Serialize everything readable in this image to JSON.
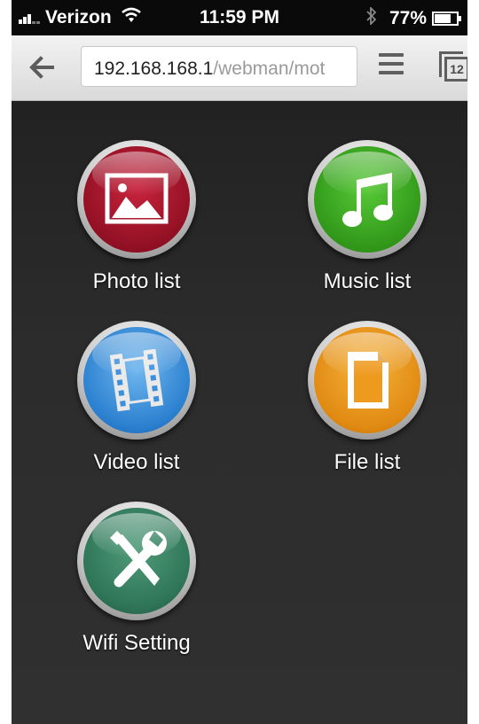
{
  "status_bar": {
    "carrier": "Verizon",
    "time": "11:59 PM",
    "battery": "77%",
    "icons": [
      "signal-icon",
      "wifi-icon",
      "bluetooth-icon",
      "battery-icon"
    ]
  },
  "browser": {
    "url_host": "192.168.168.1",
    "url_path": "/webman/mot",
    "tab_count": "12",
    "icons": [
      "back-arrow-icon",
      "menu-icon",
      "tabs-icon"
    ]
  },
  "tiles": [
    {
      "label": "Photo list",
      "icon": "photo-icon",
      "color": "#a8142c"
    },
    {
      "label": "Music list",
      "icon": "music-note-icon",
      "color": "#3aa61f"
    },
    {
      "label": "Video list",
      "icon": "film-strip-icon",
      "color": "#3b8fdc"
    },
    {
      "label": "File list",
      "icon": "document-icon",
      "color": "#ee9a1f"
    },
    {
      "label": "Wifi Setting",
      "icon": "tools-icon",
      "color": "#3a8464"
    }
  ]
}
